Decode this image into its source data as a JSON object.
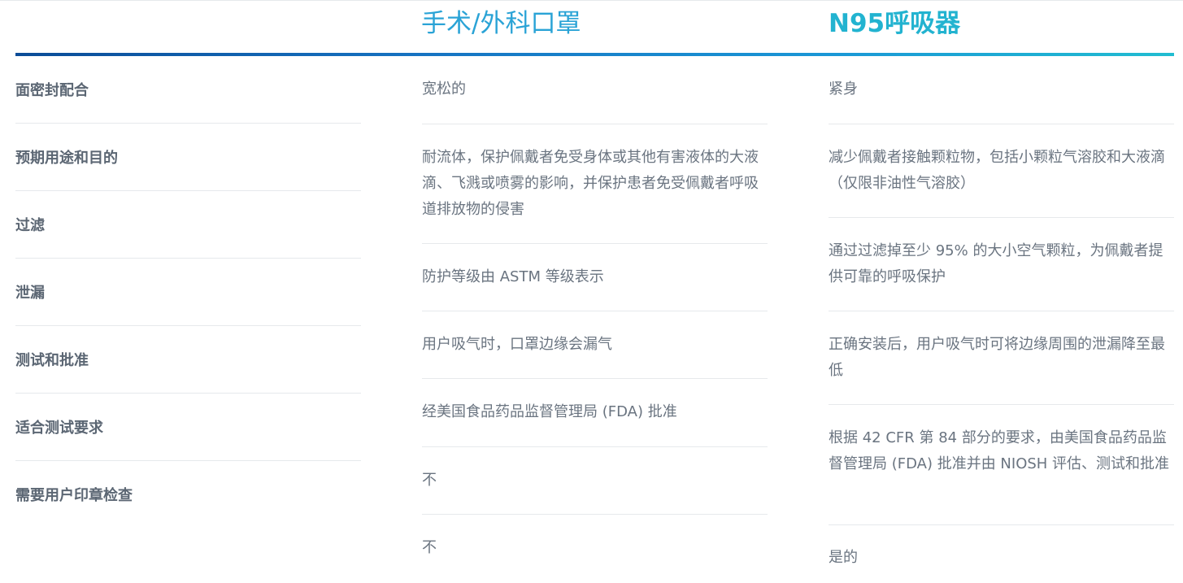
{
  "header": {
    "surgical_title": "手术/外科口罩",
    "n95_title": "N95呼吸器"
  },
  "labels": [
    "面密封配合",
    "预期用途和目的",
    "过滤",
    "泄漏",
    "测试和批准",
    "适合测试要求",
    "需要用户印章检查"
  ],
  "surgical_values": [
    "宽松的",
    "耐流体，保护佩戴者免受身体或其他有害液体的大液滴、飞溅或喷雾的影响，并保护患者免受佩戴者呼吸道排放物的侵害",
    "防护等级由 ASTM 等级表示",
    "用户吸气时，口罩边缘会漏气",
    "经美国食品药品监督管理局 (FDA) 批准",
    "不",
    "不"
  ],
  "n95_values": [
    "紧身",
    "减少佩戴者接触颗粒物，包括小颗粒气溶胶和大液滴（仅限非油性气溶胶）",
    "通过过滤掉至少 95% 的大小空气颗粒，为佩戴者提供可靠的呼吸保护",
    "正确安装后，用户吸气时可将边缘周围的泄漏降至最低",
    "根据 42 CFR 第 84 部分的要求，由美国食品药品监督管理局 (FDA) 批准并由 NIOSH 评估、测试和批准",
    "是的"
  ],
  "colors": {
    "title_blue": "#2aa3d6",
    "title_teal": "#22b3d0",
    "bar_start": "#0b4c97",
    "bar_end": "#21bdd1",
    "text": "#6a7480"
  }
}
